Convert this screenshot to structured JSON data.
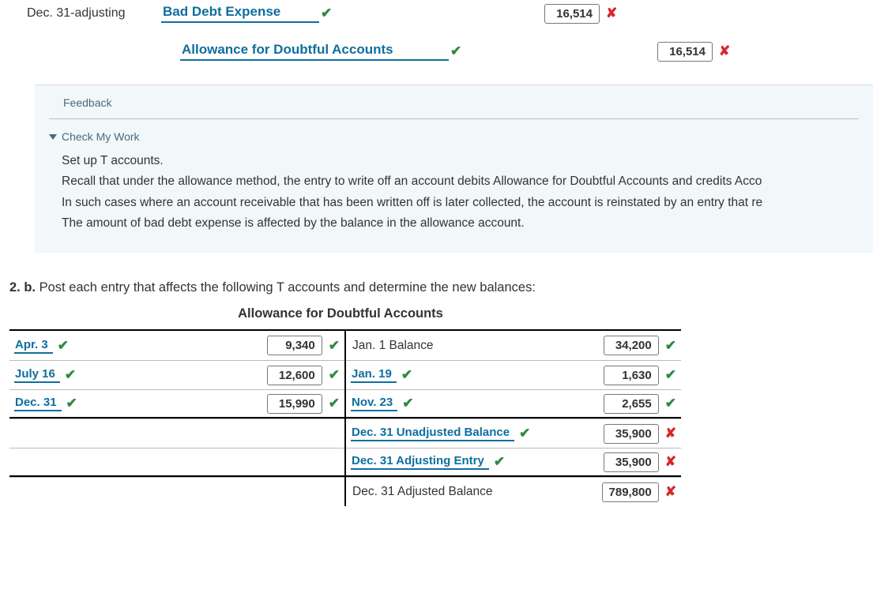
{
  "journal": {
    "date": "Dec. 31-adjusting",
    "debit_account": "Bad Debt Expense",
    "debit_mark": "ok",
    "debit_amount": "16,514",
    "debit_amount_mark": "bad",
    "credit_account": "Allowance for Doubtful Accounts",
    "credit_mark": "ok",
    "credit_amount": "16,514",
    "credit_amount_mark": "bad"
  },
  "feedback": {
    "title": "Feedback",
    "cmw": "Check My Work",
    "lines": [
      "Set up T accounts.",
      "Recall that under the allowance method, the entry to write off an account debits Allowance for Doubtful Accounts and credits Acco",
      "In such cases where an account receivable that has been written off is later collected, the account is reinstated by an entry that re",
      "The amount of bad debt expense is affected by the balance in the allowance account."
    ]
  },
  "q": {
    "num": "2. b.",
    "text": " Post each entry that affects the following T accounts and determine the new balances:"
  },
  "t": {
    "title": "Allowance for Doubtful Accounts",
    "left": [
      {
        "label": "Apr. 3",
        "label_mark": "ok",
        "amt": "9,340",
        "amt_mark": "ok"
      },
      {
        "label": "July 16",
        "label_mark": "ok",
        "amt": "12,600",
        "amt_mark": "ok"
      },
      {
        "label": "Dec. 31",
        "label_mark": "ok",
        "amt": "15,990",
        "amt_mark": "ok"
      }
    ],
    "right_top": [
      {
        "plain": true,
        "label": "Jan. 1 Balance",
        "amt": "34,200",
        "amt_mark": "ok"
      },
      {
        "label": "Jan. 19",
        "label_mark": "ok",
        "amt": "1,630",
        "amt_mark": "ok"
      },
      {
        "label": "Nov. 23",
        "label_mark": "ok",
        "amt": "2,655",
        "amt_mark": "ok"
      }
    ],
    "right_mid": [
      {
        "label": "Dec. 31 Unadjusted Balance",
        "label_mark": "ok",
        "amt": "35,900",
        "amt_mark": "bad"
      },
      {
        "label": "Dec. 31 Adjusting Entry",
        "label_mark": "ok",
        "amt": "35,900",
        "amt_mark": "bad"
      }
    ],
    "right_bot": [
      {
        "plain": true,
        "label": "Dec. 31 Adjusted Balance",
        "amt": "789,800",
        "amt_mark": "bad"
      }
    ]
  },
  "glyph": {
    "ok": "✔",
    "bad": "✘"
  }
}
